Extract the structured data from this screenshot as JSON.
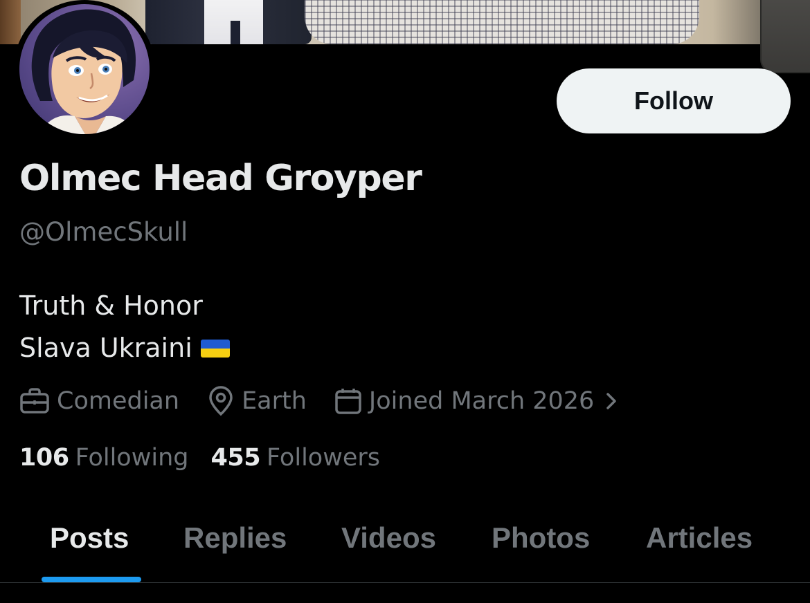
{
  "profile": {
    "display_name": "Olmec Head Groyper",
    "handle": "@OlmecSkull",
    "follow_label": "Follow",
    "bio": {
      "line1": "Truth & Honor",
      "line2": "Slava Ukraini",
      "line2_emoji": "ukraine-flag"
    },
    "meta": {
      "profession": "Comedian",
      "location": "Earth",
      "joined": "Joined March 2026"
    },
    "stats": {
      "following_count": "106",
      "following_label": "Following",
      "followers_count": "455",
      "followers_label": "Followers"
    }
  },
  "tabs": [
    {
      "label": "Posts",
      "active": true
    },
    {
      "label": "Replies",
      "active": false
    },
    {
      "label": "Videos",
      "active": false
    },
    {
      "label": "Photos",
      "active": false
    },
    {
      "label": "Articles",
      "active": false
    }
  ],
  "colors": {
    "background": "#000000",
    "primary_text": "#e7e9ea",
    "secondary_text": "#71767b",
    "follow_button_bg": "#eff3f4",
    "follow_button_text": "#0f1419",
    "accent": "#1d9bf0",
    "flag_blue": "#1f5bd1",
    "flag_yellow": "#f6cf12"
  },
  "icons": {
    "profession": "briefcase-icon",
    "location": "location-pin-icon",
    "joined": "calendar-icon",
    "joined_chevron": "chevron-right-icon"
  }
}
